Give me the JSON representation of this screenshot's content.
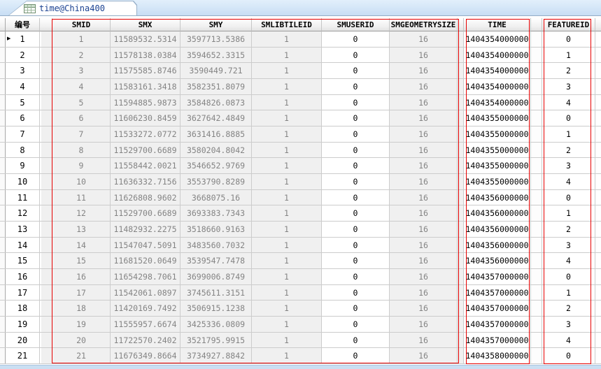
{
  "tab": {
    "title": "time@China400"
  },
  "icons": {
    "current_row_arrow": "▶",
    "tab_icon": "attribute-table-grid"
  },
  "colors": {
    "annotation_red": "#e60000",
    "tab_label_navy": "#1a4191",
    "readonly_cell_bg": "#f0f0f0",
    "readonly_text_gray": "#848484",
    "tabbar_blue": "#c8def4"
  },
  "table": {
    "row_header_label": "编号",
    "columns": {
      "smid": "SMID",
      "smx": "SMX",
      "smy": "SMY",
      "smlibtileid": "SMLIBTILEID",
      "smuserid": "SMUSERID",
      "smgeometrysize": "SMGEOMETRYSIZE",
      "time": "TIME",
      "featureid": "FEATUREID"
    },
    "rows": [
      {
        "num": "1",
        "smid": "1",
        "smx": "11589532.5314",
        "smy": "3597713.5386",
        "smlibtileid": "1",
        "smuserid": "0",
        "smgeometrysize": "16",
        "time": "1404354000000",
        "featureid": "0"
      },
      {
        "num": "2",
        "smid": "2",
        "smx": "11578138.0384",
        "smy": "3594652.3315",
        "smlibtileid": "1",
        "smuserid": "0",
        "smgeometrysize": "16",
        "time": "1404354000000",
        "featureid": "1"
      },
      {
        "num": "3",
        "smid": "3",
        "smx": "11575585.8746",
        "smy": "3590449.721",
        "smlibtileid": "1",
        "smuserid": "0",
        "smgeometrysize": "16",
        "time": "1404354000000",
        "featureid": "2"
      },
      {
        "num": "4",
        "smid": "4",
        "smx": "11583161.3418",
        "smy": "3582351.8079",
        "smlibtileid": "1",
        "smuserid": "0",
        "smgeometrysize": "16",
        "time": "1404354000000",
        "featureid": "3"
      },
      {
        "num": "5",
        "smid": "5",
        "smx": "11594885.9873",
        "smy": "3584826.0873",
        "smlibtileid": "1",
        "smuserid": "0",
        "smgeometrysize": "16",
        "time": "1404354000000",
        "featureid": "4"
      },
      {
        "num": "6",
        "smid": "6",
        "smx": "11606230.8459",
        "smy": "3627642.4849",
        "smlibtileid": "1",
        "smuserid": "0",
        "smgeometrysize": "16",
        "time": "1404355000000",
        "featureid": "0"
      },
      {
        "num": "7",
        "smid": "7",
        "smx": "11533272.0772",
        "smy": "3631416.8885",
        "smlibtileid": "1",
        "smuserid": "0",
        "smgeometrysize": "16",
        "time": "1404355000000",
        "featureid": "1"
      },
      {
        "num": "8",
        "smid": "8",
        "smx": "11529700.6689",
        "smy": "3580204.8042",
        "smlibtileid": "1",
        "smuserid": "0",
        "smgeometrysize": "16",
        "time": "1404355000000",
        "featureid": "2"
      },
      {
        "num": "9",
        "smid": "9",
        "smx": "11558442.0021",
        "smy": "3546652.9769",
        "smlibtileid": "1",
        "smuserid": "0",
        "smgeometrysize": "16",
        "time": "1404355000000",
        "featureid": "3"
      },
      {
        "num": "10",
        "smid": "10",
        "smx": "11636332.7156",
        "smy": "3553790.8289",
        "smlibtileid": "1",
        "smuserid": "0",
        "smgeometrysize": "16",
        "time": "1404355000000",
        "featureid": "4"
      },
      {
        "num": "11",
        "smid": "11",
        "smx": "11626808.9602",
        "smy": "3668075.16",
        "smlibtileid": "1",
        "smuserid": "0",
        "smgeometrysize": "16",
        "time": "1404356000000",
        "featureid": "0"
      },
      {
        "num": "12",
        "smid": "12",
        "smx": "11529700.6689",
        "smy": "3693383.7343",
        "smlibtileid": "1",
        "smuserid": "0",
        "smgeometrysize": "16",
        "time": "1404356000000",
        "featureid": "1"
      },
      {
        "num": "13",
        "smid": "13",
        "smx": "11482932.2275",
        "smy": "3518660.9163",
        "smlibtileid": "1",
        "smuserid": "0",
        "smgeometrysize": "16",
        "time": "1404356000000",
        "featureid": "2"
      },
      {
        "num": "14",
        "smid": "14",
        "smx": "11547047.5091",
        "smy": "3483560.7032",
        "smlibtileid": "1",
        "smuserid": "0",
        "smgeometrysize": "16",
        "time": "1404356000000",
        "featureid": "3"
      },
      {
        "num": "15",
        "smid": "15",
        "smx": "11681520.0649",
        "smy": "3539547.7478",
        "smlibtileid": "1",
        "smuserid": "0",
        "smgeometrysize": "16",
        "time": "1404356000000",
        "featureid": "4"
      },
      {
        "num": "16",
        "smid": "16",
        "smx": "11654298.7061",
        "smy": "3699006.8749",
        "smlibtileid": "1",
        "smuserid": "0",
        "smgeometrysize": "16",
        "time": "1404357000000",
        "featureid": "0"
      },
      {
        "num": "17",
        "smid": "17",
        "smx": "11542061.0897",
        "smy": "3745611.3151",
        "smlibtileid": "1",
        "smuserid": "0",
        "smgeometrysize": "16",
        "time": "1404357000000",
        "featureid": "1"
      },
      {
        "num": "18",
        "smid": "18",
        "smx": "11420169.7492",
        "smy": "3506915.1238",
        "smlibtileid": "1",
        "smuserid": "0",
        "smgeometrysize": "16",
        "time": "1404357000000",
        "featureid": "2"
      },
      {
        "num": "19",
        "smid": "19",
        "smx": "11555957.6674",
        "smy": "3425336.0809",
        "smlibtileid": "1",
        "smuserid": "0",
        "smgeometrysize": "16",
        "time": "1404357000000",
        "featureid": "3"
      },
      {
        "num": "20",
        "smid": "20",
        "smx": "11722570.2402",
        "smy": "3521795.9915",
        "smlibtileid": "1",
        "smuserid": "0",
        "smgeometrysize": "16",
        "time": "1404357000000",
        "featureid": "4"
      },
      {
        "num": "21",
        "smid": "21",
        "smx": "11676349.8664",
        "smy": "3734927.8842",
        "smlibtileid": "1",
        "smuserid": "0",
        "smgeometrysize": "16",
        "time": "1404358000000",
        "featureid": "0"
      }
    ]
  }
}
